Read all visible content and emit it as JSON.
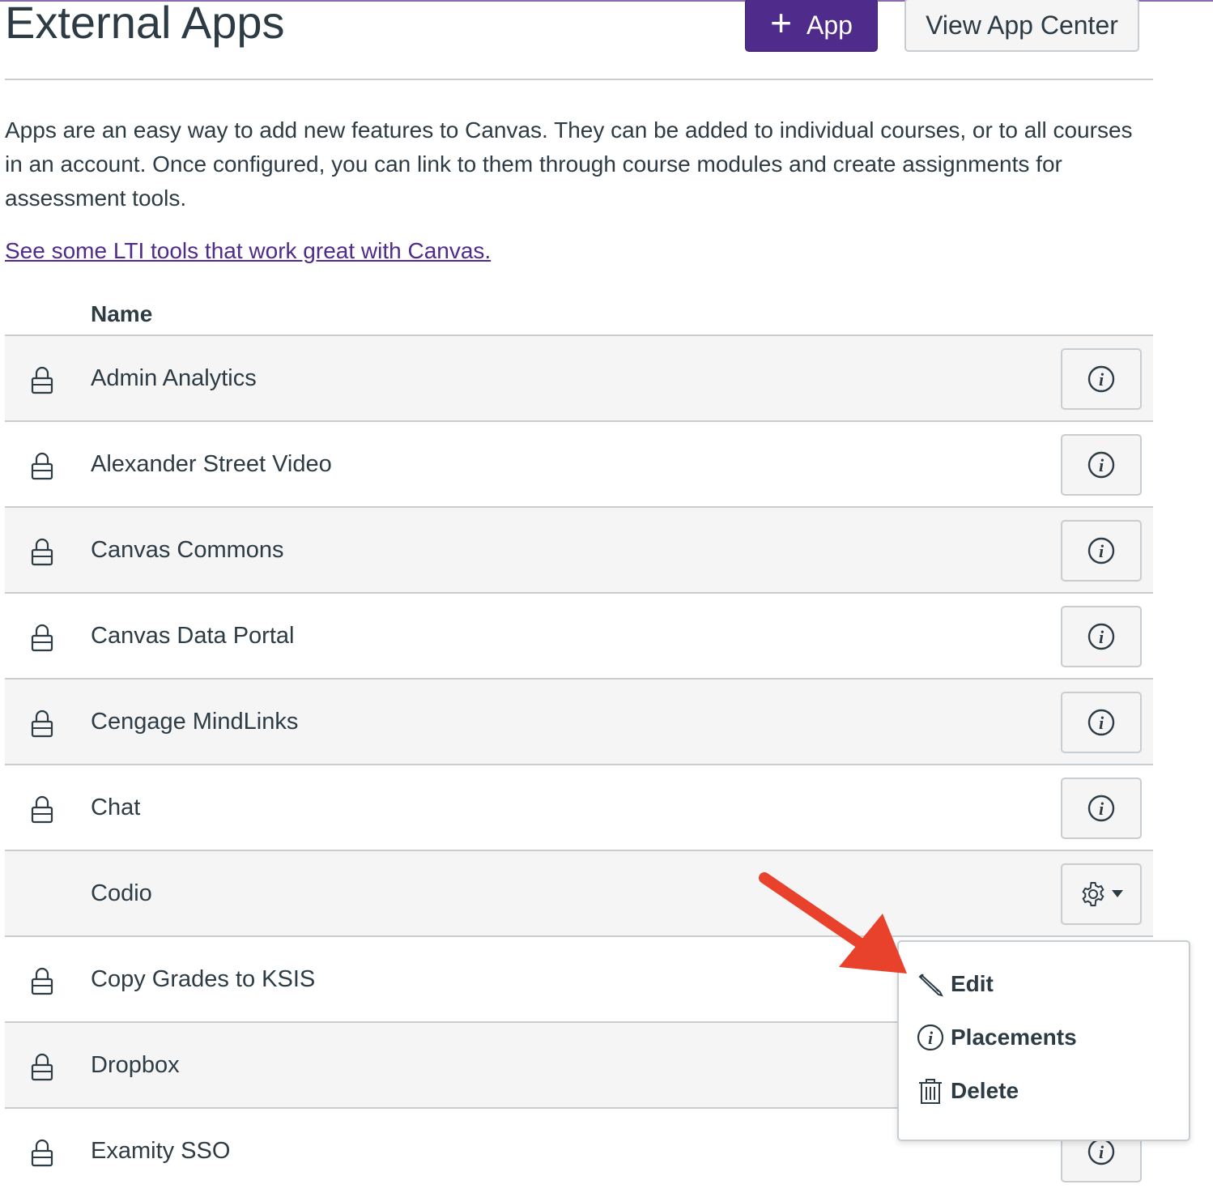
{
  "header": {
    "title": "External Apps",
    "add_button_label": "App",
    "app_center_button_label": "View App Center"
  },
  "intro": {
    "text": "Apps are an easy way to add new features to Canvas. They can be added to individual courses, or to all courses in an account. Once configured, you can link to them through course modules and create assignments for assessment tools.",
    "link_text": "See some LTI tools that work great with Canvas."
  },
  "table": {
    "column_name": "Name",
    "rows": [
      {
        "name": "Admin Analytics",
        "locked": true,
        "action": "info"
      },
      {
        "name": "Alexander Street Video",
        "locked": true,
        "action": "info"
      },
      {
        "name": "Canvas Commons",
        "locked": true,
        "action": "info"
      },
      {
        "name": "Canvas Data Portal",
        "locked": true,
        "action": "info"
      },
      {
        "name": "Cengage MindLinks",
        "locked": true,
        "action": "info"
      },
      {
        "name": "Chat",
        "locked": true,
        "action": "info"
      },
      {
        "name": "Codio",
        "locked": false,
        "action": "settings"
      },
      {
        "name": "Copy Grades to KSIS",
        "locked": true,
        "action": "info"
      },
      {
        "name": "Dropbox",
        "locked": true,
        "action": "info"
      },
      {
        "name": "Examity SSO",
        "locked": true,
        "action": "info"
      }
    ]
  },
  "settings_menu": {
    "items": [
      {
        "label": "Edit",
        "icon": "pencil-icon"
      },
      {
        "label": "Placements",
        "icon": "info-icon"
      },
      {
        "label": "Delete",
        "icon": "trash-icon"
      }
    ]
  },
  "colors": {
    "brand_purple": "#4f2b8b",
    "text": "#2d3b45",
    "border": "#c7cdd1",
    "stripe": "#f5f5f5",
    "annotation_arrow": "#e8412c"
  }
}
